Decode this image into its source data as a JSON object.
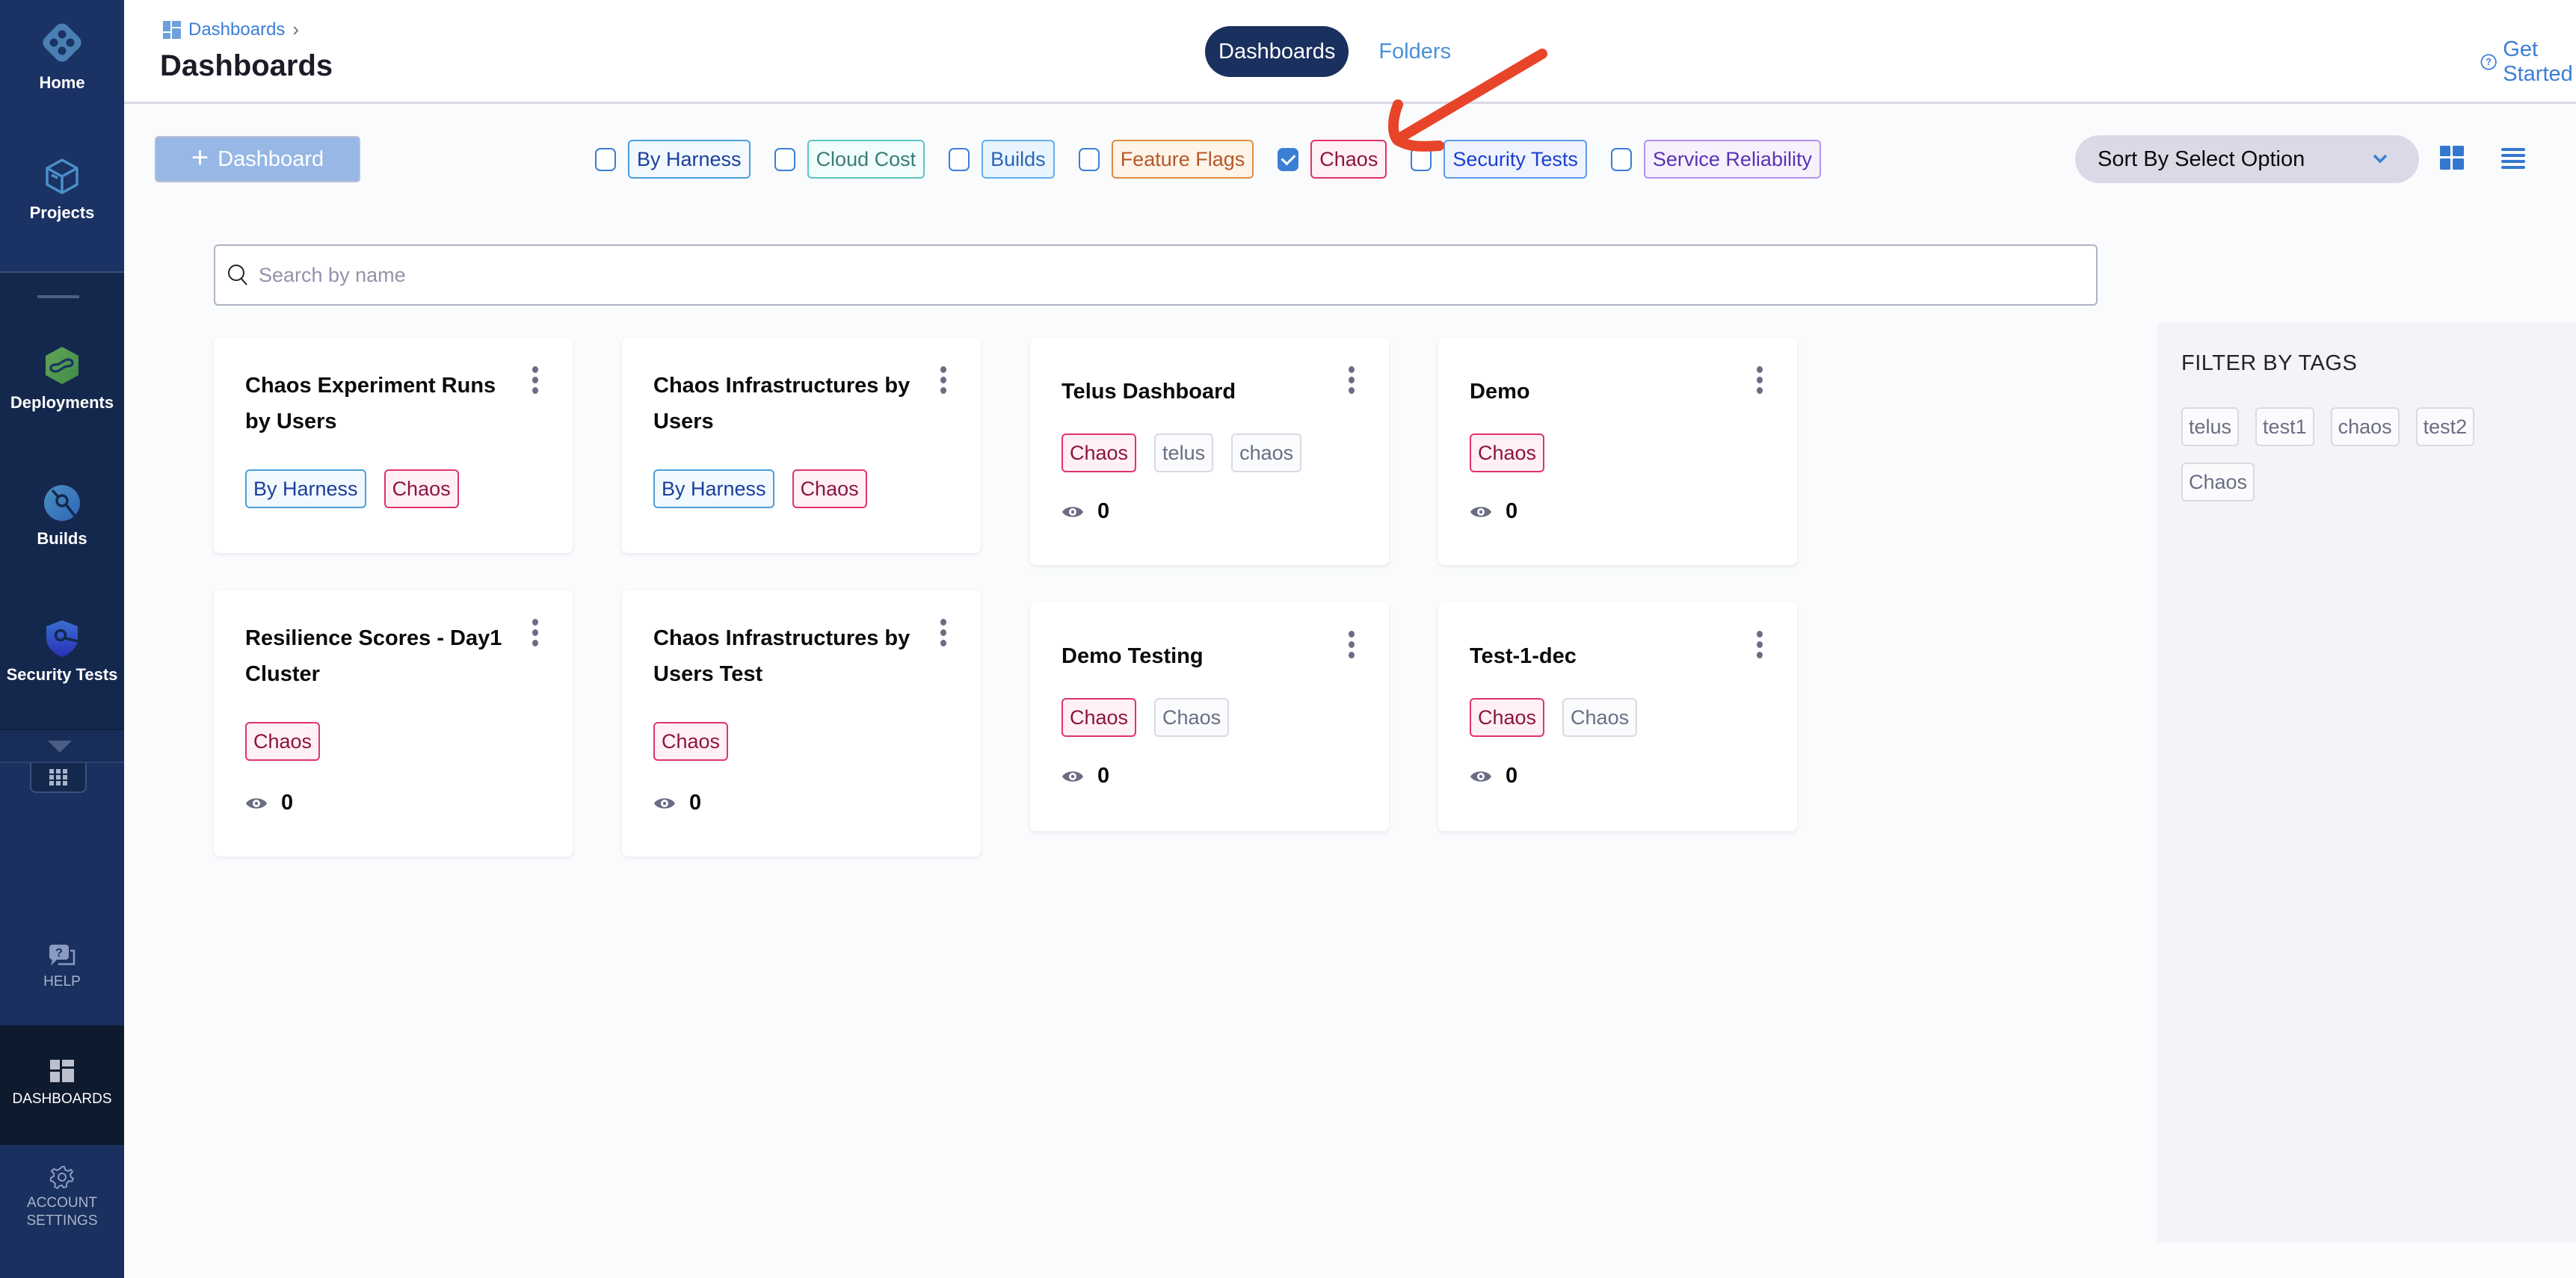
{
  "sidebar": {
    "items": [
      {
        "label": "Home",
        "icon": "harness-home-icon"
      },
      {
        "label": "Projects",
        "icon": "cube-icon"
      },
      {
        "label": "Deployments",
        "icon": "deployments-icon"
      },
      {
        "label": "Builds",
        "icon": "builds-icon"
      },
      {
        "label": "Security Tests",
        "icon": "security-shield-icon"
      }
    ],
    "bottom": [
      {
        "label": "HELP",
        "icon": "help-chat-icon"
      },
      {
        "label": "DASHBOARDS",
        "icon": "dashboards-icon"
      },
      {
        "label_line1": "ACCOUNT",
        "label_line2": "SETTINGS",
        "icon": "gear-icon"
      }
    ]
  },
  "header": {
    "breadcrumb": "Dashboards",
    "title": "Dashboards",
    "tabs": [
      {
        "label": "Dashboards",
        "active": true
      },
      {
        "label": "Folders",
        "active": false
      }
    ],
    "get_started": "Get Started"
  },
  "toolbar": {
    "add_dashboard": "Dashboard",
    "filters": [
      {
        "label": "By Harness",
        "checked": false,
        "color": "#1b3e99",
        "border": "#4a9fdb",
        "bg": "#f2f9fe"
      },
      {
        "label": "Cloud Cost",
        "checked": false,
        "color": "#3a7d76",
        "border": "#5cc6c4",
        "bg": "#f0fdfc"
      },
      {
        "label": "Builds",
        "checked": false,
        "color": "#2e64b4",
        "border": "#62aef0",
        "bg": "#e9f5fe"
      },
      {
        "label": "Feature Flags",
        "checked": false,
        "color": "#b5582a",
        "border": "#e08b42",
        "bg": "#fef4e8"
      },
      {
        "label": "Chaos",
        "checked": true,
        "color": "#8b1542",
        "border": "#e0336b",
        "bg": "#fff0f5"
      },
      {
        "label": "Security Tests",
        "checked": false,
        "color": "#1c3fd1",
        "border": "#5f9ae9",
        "bg": "#eef3fe"
      },
      {
        "label": "Service Reliability",
        "checked": false,
        "color": "#5a32b3",
        "border": "#b291f0",
        "bg": "#f7f1fe"
      }
    ],
    "sort": {
      "selected": "Sort By Select Option"
    }
  },
  "search": {
    "placeholder": "Search by name",
    "value": ""
  },
  "cards": [
    {
      "title": "Chaos Experiment Runs by Users",
      "tags": [
        "By Harness",
        "Chaos"
      ],
      "views": null
    },
    {
      "title": "Chaos Infrastructures by Users",
      "tags": [
        "By Harness",
        "Chaos"
      ],
      "views": null
    },
    {
      "title": "Telus Dashboard",
      "tags": [
        "Chaos",
        "telus",
        "chaos"
      ],
      "views": "0"
    },
    {
      "title": "Demo",
      "tags": [
        "Chaos"
      ],
      "views": "0"
    },
    {
      "title": "Resilience Scores - Day1 Cluster",
      "tags": [
        "Chaos"
      ],
      "views": "0"
    },
    {
      "title": "Chaos Infrastructures by Users Test",
      "tags": [
        "Chaos"
      ],
      "views": "0"
    },
    {
      "title": "Demo Testing",
      "tags": [
        "Chaos",
        "Chaos"
      ],
      "views": "0"
    },
    {
      "title": "Test-1-dec",
      "tags": [
        "Chaos",
        "Chaos"
      ],
      "views": "0"
    }
  ],
  "filter_panel": {
    "title": "FILTER BY TAGS",
    "tags": [
      "telus",
      "test1",
      "chaos",
      "test2",
      "Chaos"
    ]
  },
  "tag_styles": {
    "By Harness": {
      "color": "#1b3e99",
      "border": "#4a9fdb",
      "bg": "#f2f9fe"
    },
    "Chaos": {
      "color": "#8b1542",
      "border": "#e0336b",
      "bg": "#fff0f5"
    },
    "custom": {
      "color": "#6b6d85",
      "border": "#d9dae5",
      "bg": "#fafbfd"
    }
  },
  "annotation": {
    "type": "arrow",
    "color": "#e8442a",
    "points_to": "Chaos filter"
  }
}
